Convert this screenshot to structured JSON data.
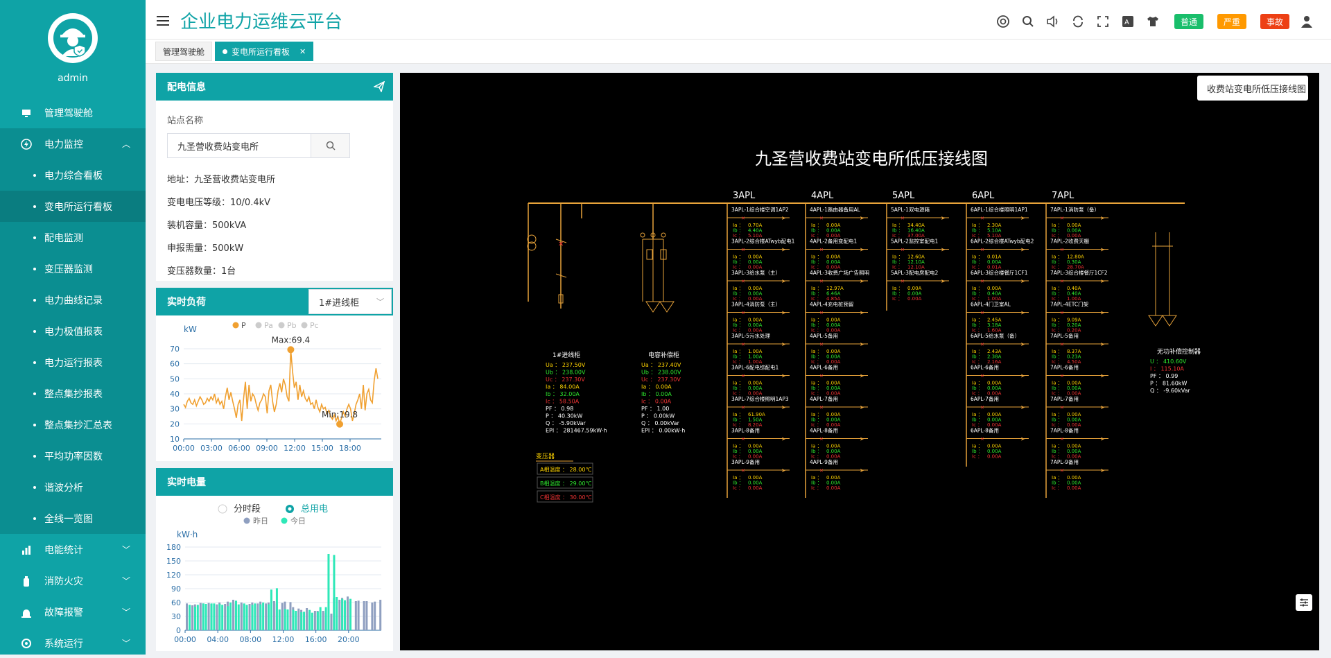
{
  "user": {
    "name": "admin"
  },
  "menu": {
    "cockpit": "管理驾驶舱",
    "power_monitor": "电力监控",
    "sub": [
      "电力综合看板",
      "变电所运行看板",
      "配电监测",
      "变压器监测",
      "电力曲线记录",
      "电力极值报表",
      "电力运行报表",
      "整点集抄报表",
      "整点集抄汇总表",
      "平均功率因数",
      "谐波分析",
      "全线一览图"
    ],
    "energy": "电能统计",
    "fire": "消防火灾",
    "fault": "故障报警",
    "system": "系统运行"
  },
  "header": {
    "title": "企业电力运维云平台",
    "badges": [
      {
        "label": "普通",
        "color": "#19be6b"
      },
      {
        "label": "严重",
        "color": "#ff9900"
      },
      {
        "label": "事故",
        "color": "#ed4014"
      }
    ]
  },
  "tabs": [
    {
      "label": "管理驾驶舱"
    },
    {
      "label": "变电所运行看板"
    }
  ],
  "peidian": {
    "title": "配电信息",
    "station_label": "站点名称",
    "station_value": "九圣营收费站变电所",
    "address": "地址：九圣营收费站变电所",
    "voltage": "变电电压等级：10/0.4kV",
    "capacity": "装机容量：500kVA",
    "demand": "申报需量：500kW",
    "transformers": "变压器数量：1台"
  },
  "load": {
    "title": "实时负荷",
    "select": "1#进线柜",
    "unit": "kW",
    "legend": [
      "P",
      "Pa",
      "Pb",
      "Pc"
    ],
    "max_label": "Max:69.4",
    "min_label": "Min:19.8",
    "yticks": [
      "70",
      "60",
      "50",
      "40",
      "30",
      "20",
      "10"
    ],
    "xticks": [
      "00:00",
      "03:00",
      "06:00",
      "09:00",
      "12:00",
      "15:00",
      "18:00"
    ]
  },
  "energy_card": {
    "title": "实时电量",
    "radio1": "分时段",
    "radio2": "总用电",
    "legend": [
      "昨日",
      "今日"
    ],
    "unit": "kW·h",
    "yticks": [
      "180",
      "150",
      "120",
      "90",
      "60",
      "30",
      "0"
    ],
    "xticks": [
      "00:00",
      "04:00",
      "08:00",
      "12:00",
      "16:00",
      "20:00"
    ]
  },
  "chart_data": [
    {
      "type": "line",
      "title": "实时负荷",
      "ylabel": "kW",
      "ylim": [
        10,
        70
      ],
      "x_range": [
        "00:00",
        "19:00"
      ],
      "series": [
        {
          "name": "P",
          "values": [
            33,
            31,
            35,
            37,
            34,
            33,
            36,
            32,
            35,
            38,
            36,
            33,
            34,
            37,
            35,
            38,
            36,
            40,
            34,
            37,
            33,
            35,
            30,
            38,
            44,
            36,
            41,
            35,
            30,
            24,
            33,
            36,
            22,
            37,
            48,
            30,
            46,
            35,
            40,
            38,
            33,
            29,
            34,
            36,
            40,
            38,
            27,
            42,
            46,
            35,
            28,
            33,
            42,
            47,
            41,
            50,
            46,
            38,
            35,
            69.4,
            55,
            44,
            48,
            36,
            46,
            38,
            42,
            37,
            35,
            38,
            33,
            34,
            30,
            36,
            31,
            28,
            33,
            30,
            31,
            27,
            29,
            25,
            23,
            26,
            22,
            25,
            19.8,
            24,
            28,
            25,
            30,
            33,
            30,
            22,
            27,
            33,
            36,
            40,
            30,
            46,
            29,
            40,
            43,
            36,
            34,
            49,
            57,
            50
          ]
        }
      ],
      "annotations": [
        {
          "label": "Max:69.4",
          "value": 69.4
        },
        {
          "label": "Min:19.8",
          "value": 19.8
        }
      ]
    },
    {
      "type": "bar",
      "title": "实时电量",
      "ylabel": "kW·h",
      "ylim": [
        0,
        180
      ],
      "categories": [
        "00:00",
        "01:00",
        "02:00",
        "03:00",
        "04:00",
        "05:00",
        "06:00",
        "07:00",
        "08:00",
        "09:00",
        "10:00",
        "11:00",
        "12:00",
        "13:00",
        "14:00",
        "15:00",
        "16:00",
        "17:00",
        "18:00",
        "19:00",
        "20:00",
        "21:00",
        "22:00",
        "23:00"
      ],
      "series": [
        {
          "name": "昨日",
          "values": [
            58,
            56,
            58,
            57,
            60,
            62,
            58,
            57,
            60,
            62,
            60,
            58,
            62,
            50,
            44,
            40,
            42,
            38,
            70,
            70,
            62,
            64,
            63,
            62
          ]
        },
        {
          "name": "今日",
          "values": [
            55,
            55,
            57,
            58,
            55,
            60,
            56,
            55,
            58,
            60,
            88,
            45,
            45,
            42,
            40,
            38,
            50,
            165,
            72,
            65,
            null,
            null,
            null,
            null
          ]
        }
      ]
    }
  ],
  "diagram": {
    "selector": "收费站变电所低压接线图",
    "title": "九圣营收费站变电所低压接线图",
    "panels": [
      "3APL",
      "4APL",
      "5APL",
      "6APL",
      "7APL"
    ],
    "incoming": {
      "name": "1#进线柜",
      "rows": [
        "Ua ： 237.50V",
        "Ub ： 238.00V",
        "Uc ： 237.30V",
        "Ia ： 84.00A",
        "Ib ： 32.00A",
        "Ic ： 58.50A",
        "PF ： 0.98",
        "P ： 40.30kW",
        "Q ： -5.90kVar",
        "EPI ： 281467.59kW·h"
      ]
    },
    "capacitor": {
      "name": "电容补偿柜",
      "rows": [
        "Ua ： 237.40V",
        "Ub ： 238.00V",
        "Uc ： 237.30V",
        "Ia ： 0.00A",
        "Ib ： 0.00A",
        "Ic ： 0.00A",
        "PF ： 1.00",
        "P ： 0.00kW",
        "Q ： 0.00kVar",
        "EPI ： 0.00kW·h"
      ]
    },
    "transformer": {
      "name": "变压器",
      "rows": [
        "A相温度 ： 28.00℃",
        "B相温度 ： 29.00℃",
        "C相温度 ： 30.00℃"
      ]
    },
    "reactive": {
      "name": "无功补偿控制器",
      "rows": [
        "U ： 410.60V",
        "I ： 115.10A",
        "PF ： 0.99",
        "P ： 81.60kW",
        "Q ： -9.60kVar"
      ]
    },
    "feeders": [
      [
        {
          "name": "3APL-1综合楼空调1AP2",
          "vals": [
            "0.70A",
            "4.40A",
            "5.10A"
          ]
        },
        {
          "name": "3APL-2综合楼ATwyb配电1",
          "vals": [
            "0.00A",
            "0.00A",
            "0.00A"
          ]
        },
        {
          "name": "3APL-3给水泵（主）",
          "vals": [
            "0.00A",
            "0.00A",
            "0.00A"
          ]
        },
        {
          "name": "3APL-4消防泵（主）",
          "vals": [
            "0.00A",
            "0.00A",
            "0.00A"
          ]
        },
        {
          "name": "3APL-5污水处理",
          "vals": [
            "1.00A",
            "1.00A",
            "1.00A"
          ]
        },
        {
          "name": "3APL-6配电综配电1",
          "vals": [
            "0.00A",
            "0.00A",
            "0.00A"
          ]
        },
        {
          "name": "3APL-7综合楼照明1AP3",
          "vals": [
            "61.90A",
            "1.50A",
            "8.20A"
          ]
        },
        {
          "name": "3APL-8备用",
          "vals": [
            "0.00A",
            "0.00A",
            "0.00A"
          ]
        },
        {
          "name": "3APL-9备用",
          "vals": [
            "0.00A",
            "0.00A",
            "0.00A"
          ]
        }
      ],
      [
        {
          "name": "4APL-1路由器备用AL",
          "vals": [
            "0.00A",
            "0.00A",
            "0.00A"
          ]
        },
        {
          "name": "4APL-2备用变配电1",
          "vals": [
            "0.00A",
            "0.00A",
            "0.00A"
          ]
        },
        {
          "name": "4APL-3收费广场广告照明",
          "vals": [
            "12.97A",
            "6.46A",
            "4.85A"
          ]
        },
        {
          "name": "4APL-4充电桩预留",
          "vals": [
            "0.00A",
            "0.00A",
            "0.00A"
          ]
        },
        {
          "name": "4APL-5备用",
          "vals": [
            "0.00A",
            "0.00A",
            "0.00A"
          ]
        },
        {
          "name": "4APL-6备用",
          "vals": [
            "0.00A",
            "0.00A",
            "0.00A"
          ]
        },
        {
          "name": "4APL-7备用",
          "vals": [
            "0.00A",
            "0.00A",
            "0.00A"
          ]
        },
        {
          "name": "4APL-8备用",
          "vals": [
            "0.00A",
            "0.00A",
            "0.00A"
          ]
        },
        {
          "name": "4APL-9备用",
          "vals": [
            "0.00A",
            "0.00A",
            "0.00A"
          ]
        }
      ],
      [
        {
          "name": "5APL-1双电源箱",
          "vals": [
            "34.40A",
            "16.40A",
            "37.00A"
          ]
        },
        {
          "name": "5APL-2监控室配电1",
          "vals": [
            "12.60A",
            "12.10A",
            "12.10A"
          ]
        },
        {
          "name": "5APL-3配电房配电2",
          "vals": [
            "0.00A",
            "0.00A",
            "0.00A"
          ]
        }
      ],
      [
        {
          "name": "6APL-1综合楼照明1AP1",
          "vals": [
            "2.30A",
            "5.10A",
            "5.10A"
          ]
        },
        {
          "name": "6APL-2综合楼ATwyb配电2",
          "vals": [
            "0.01A",
            "0.00A",
            "0.01A"
          ]
        },
        {
          "name": "6APL-3综合楼餐厅1CF1",
          "vals": [
            "0.00A",
            "0.40A",
            "1.00A"
          ]
        },
        {
          "name": "6APL-4门卫室AL",
          "vals": [
            "2.45A",
            "3.18A",
            "1.60A"
          ]
        },
        {
          "name": "6APL-5给水泵（备）",
          "vals": [
            "2.43A",
            "2.38A",
            "2.16A"
          ]
        },
        {
          "name": "6APL-6备用",
          "vals": [
            "0.00A",
            "0.00A",
            "0.00A"
          ]
        },
        {
          "name": "6APL-7备用",
          "vals": [
            "0.00A",
            "0.00A",
            "0.00A"
          ]
        },
        {
          "name": "6APL-8备用",
          "vals": [
            "0.00A",
            "0.00A",
            "0.00A"
          ]
        }
      ],
      [
        {
          "name": "7APL-1消防泵（备）",
          "vals": [
            "0.00A",
            "0.00A",
            "0.00A"
          ]
        },
        {
          "name": "7APL-2收费天棚",
          "vals": [
            "12.80A",
            "0.30A",
            "28.70A"
          ]
        },
        {
          "name": "7APL-3综合楼餐厅1CF2",
          "vals": [
            "0.40A",
            "0.40A",
            "1.00A"
          ]
        },
        {
          "name": "7APL-4ETC门架",
          "vals": [
            "9.09A",
            "0.20A",
            "0.20A"
          ]
        },
        {
          "name": "7APL-5备用",
          "vals": [
            "8.37A",
            "0.23A",
            "4.50A"
          ]
        },
        {
          "name": "7APL-6备用",
          "vals": [
            "0.00A",
            "0.00A",
            "0.00A"
          ]
        },
        {
          "name": "7APL-7备用",
          "vals": [
            "0.00A",
            "0.00A",
            "0.00A"
          ]
        },
        {
          "name": "7APL-8备用",
          "vals": [
            "0.00A",
            "0.00A",
            "0.00A"
          ]
        },
        {
          "name": "7APL-9备用",
          "vals": [
            "0.00A",
            "0.00A",
            "0.00A"
          ]
        }
      ]
    ]
  }
}
